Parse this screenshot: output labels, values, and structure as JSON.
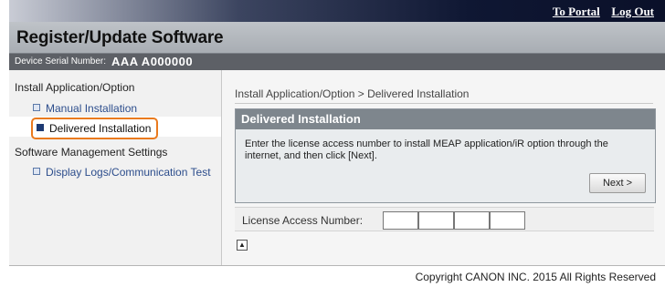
{
  "top_links": {
    "portal": "To Portal",
    "logout": "Log Out"
  },
  "title": "Register/Update Software",
  "serial": {
    "label": "Device Serial Number:",
    "value": "AAA A000000"
  },
  "nav": {
    "section1": "Install Application/Option",
    "item_manual": "Manual Installation",
    "item_delivered": "Delivered Installation",
    "section2": "Software Management Settings",
    "item_logs": "Display Logs/Communication Test"
  },
  "main": {
    "breadcrumb": "Install Application/Option > Delivered Installation",
    "panel_title": "Delivered Installation",
    "description": "Enter the license access number to install MEAP application/iR option through the internet, and then click [Next].",
    "next_button": "Next >",
    "license_label": "License Access Number:",
    "license_fields": [
      "",
      "",
      "",
      ""
    ],
    "top_icon": "back-to-top-icon"
  },
  "footer": "Copyright CANON INC. 2015 All Rights Reserved",
  "colors": {
    "selection_outline": "#ea7a1e",
    "title_gradient": "#0a1029",
    "link": "#2c4d8c"
  }
}
